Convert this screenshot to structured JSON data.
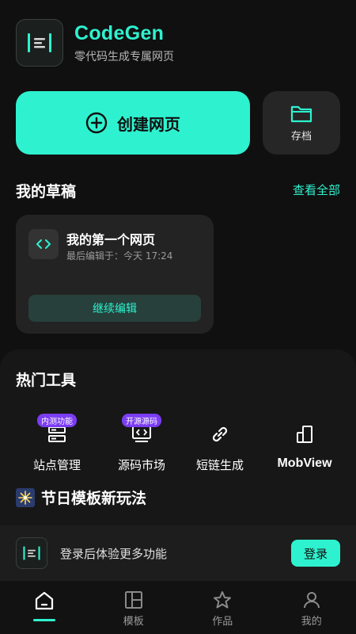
{
  "app": {
    "title": "CodeGen",
    "subtitle": "零代码生成专属网页"
  },
  "actions": {
    "create_label": "创建网页",
    "archive_label": "存档"
  },
  "drafts": {
    "title": "我的草稿",
    "view_all": "查看全部",
    "items": [
      {
        "title": "我的第一个网页",
        "time": "最后编辑于：今天 17:24",
        "button": "继续编辑"
      }
    ]
  },
  "tools": {
    "title": "热门工具",
    "items": [
      {
        "label": "站点管理",
        "badge": "内测功能",
        "icon": "server-icon"
      },
      {
        "label": "源码市场",
        "badge": "开源源码",
        "icon": "code-monitor-icon"
      },
      {
        "label": "短链生成",
        "badge": "",
        "icon": "link-icon"
      },
      {
        "label": "MobView",
        "badge": "",
        "icon": "mobile-icon"
      }
    ]
  },
  "festival": {
    "icon": "fireworks-icon",
    "title": "节日模板新玩法"
  },
  "login_bar": {
    "text": "登录后体验更多功能",
    "button": "登录"
  },
  "tabbar": {
    "active": 0,
    "items": [
      {
        "label": "",
        "icon": "home-icon"
      },
      {
        "label": "模板",
        "icon": "template-icon"
      },
      {
        "label": "作品",
        "icon": "star-icon"
      },
      {
        "label": "我的",
        "icon": "user-icon"
      }
    ]
  },
  "colors": {
    "accent": "#2ef2cf",
    "background": "#101010",
    "card": "#232323",
    "badge": "#7b3df2"
  }
}
